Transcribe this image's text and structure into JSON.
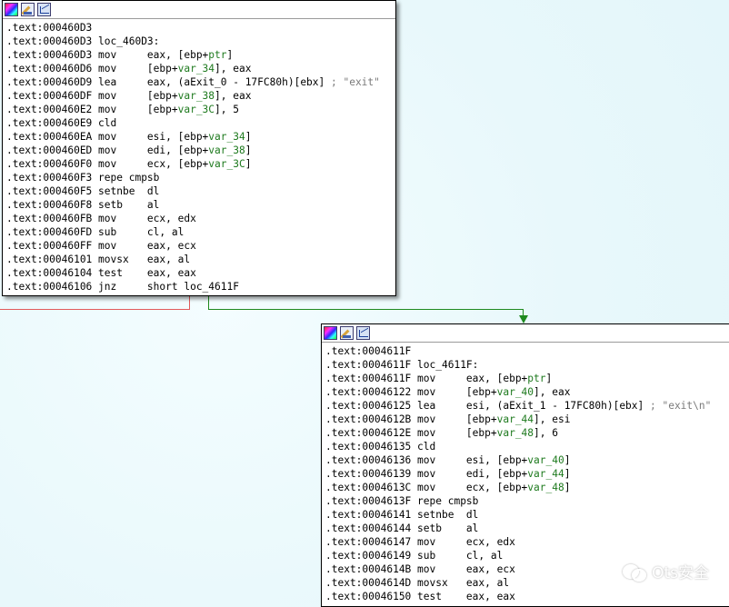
{
  "node1": {
    "lines": [
      [
        ".text:000460D3",
        ""
      ],
      [
        ".text:000460D3",
        "loc_460D3:"
      ],
      [
        ".text:000460D3",
        "mov     eax, [ebp+",
        "ptr",
        "]"
      ],
      [
        ".text:000460D6",
        "mov     [ebp+",
        "var_34",
        "], eax"
      ],
      [
        ".text:000460D9",
        "lea     eax, (aExit_0 - 17FC80h)[ebx] ",
        "; \"exit\""
      ],
      [
        ".text:000460DF",
        "mov     [ebp+",
        "var_38",
        "], eax"
      ],
      [
        ".text:000460E2",
        "mov     [ebp+",
        "var_3C",
        "], 5"
      ],
      [
        ".text:000460E9",
        "cld"
      ],
      [
        ".text:000460EA",
        "mov     esi, [ebp+",
        "var_34",
        "]"
      ],
      [
        ".text:000460ED",
        "mov     edi, [ebp+",
        "var_38",
        "]"
      ],
      [
        ".text:000460F0",
        "mov     ecx, [ebp+",
        "var_3C",
        "]"
      ],
      [
        ".text:000460F3",
        "repe cmpsb"
      ],
      [
        ".text:000460F5",
        "setnbe  dl"
      ],
      [
        ".text:000460F8",
        "setb    al"
      ],
      [
        ".text:000460FB",
        "mov     ecx, edx"
      ],
      [
        ".text:000460FD",
        "sub     cl, al"
      ],
      [
        ".text:000460FF",
        "mov     eax, ecx"
      ],
      [
        ".text:00046101",
        "movsx   eax, al"
      ],
      [
        ".text:00046104",
        "test    eax, eax"
      ],
      [
        ".text:00046106",
        "jnz     short loc_4611F"
      ]
    ]
  },
  "node2": {
    "lines": [
      [
        ".text:0004611F",
        ""
      ],
      [
        ".text:0004611F",
        "loc_4611F:"
      ],
      [
        ".text:0004611F",
        "mov     eax, [ebp+",
        "ptr",
        "]"
      ],
      [
        ".text:00046122",
        "mov     [ebp+",
        "var_40",
        "], eax"
      ],
      [
        ".text:00046125",
        "lea     esi, (aExit_1 - 17FC80h)[ebx] ",
        "; \"exit\\n\""
      ],
      [
        ".text:0004612B",
        "mov     [ebp+",
        "var_44",
        "], esi"
      ],
      [
        ".text:0004612E",
        "mov     [ebp+",
        "var_48",
        "], 6"
      ],
      [
        ".text:00046135",
        "cld"
      ],
      [
        ".text:00046136",
        "mov     esi, [ebp+",
        "var_40",
        "]"
      ],
      [
        ".text:00046139",
        "mov     edi, [ebp+",
        "var_44",
        "]"
      ],
      [
        ".text:0004613C",
        "mov     ecx, [ebp+",
        "var_48",
        "]"
      ],
      [
        ".text:0004613F",
        "repe cmpsb"
      ],
      [
        ".text:00046141",
        "setnbe  dl"
      ],
      [
        ".text:00046144",
        "setb    al"
      ],
      [
        ".text:00046147",
        "mov     ecx, edx"
      ],
      [
        ".text:00046149",
        "sub     cl, al"
      ],
      [
        ".text:0004614B",
        "mov     eax, ecx"
      ],
      [
        ".text:0004614D",
        "movsx   eax, al"
      ],
      [
        ".text:00046150",
        "test    eax, eax"
      ]
    ]
  },
  "header_icons": [
    "node-color-icon",
    "edit-node-icon",
    "graph-overview-icon"
  ],
  "colors": {
    "background": "#eefbfd",
    "var_color": "#1e7a1e",
    "comment_color": "#7a7a7a",
    "false_edge": "#e25b5b",
    "true_edge": "#1f8a1f"
  },
  "watermark": {
    "icon": "wechat-icon",
    "text": "Ots安全"
  }
}
